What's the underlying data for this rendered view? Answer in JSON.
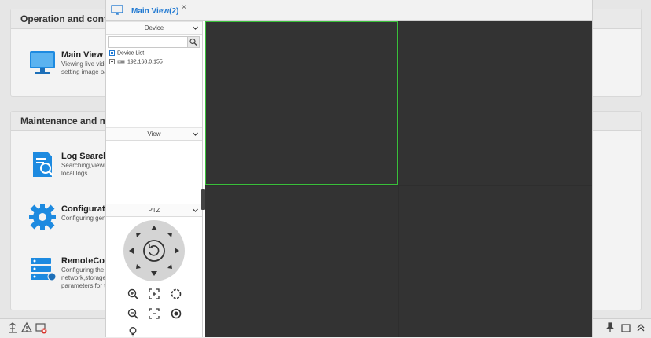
{
  "home": {
    "section_operation": "Operation and control",
    "section_maintenance": "Maintenance and mana",
    "items": [
      {
        "title": "Main View",
        "desc": [
          "Viewing live vide",
          "setting image par"
        ]
      },
      {
        "title": "Log Search",
        "desc": [
          "Searching,viewin",
          "local logs."
        ]
      },
      {
        "title": "Configuration",
        "desc": [
          "Configuring gene"
        ]
      },
      {
        "title": "RemoteConfig",
        "desc": [
          "Configuring the",
          "network,storage,",
          "parameters for th"
        ]
      }
    ]
  },
  "window": {
    "tab_label": "Main View(2)",
    "tab_close": "×"
  },
  "sidebar": {
    "device_dropdown": "Device",
    "search_placeholder": "",
    "tree": {
      "root": "Device List",
      "device": "192.168.0.155"
    },
    "view_dropdown": "View",
    "ptz_dropdown": "PTZ"
  },
  "icons": {
    "tab": "monitor-icon",
    "status": [
      "network-icon",
      "alarm-icon",
      "record-error-icon"
    ],
    "status_right": [
      "pin-icon",
      "window-icon",
      "collapse-up-icon"
    ]
  },
  "colors": {
    "accent": "#1f78d1",
    "selected_cell": "#39c03a",
    "video_bg": "#333333"
  }
}
